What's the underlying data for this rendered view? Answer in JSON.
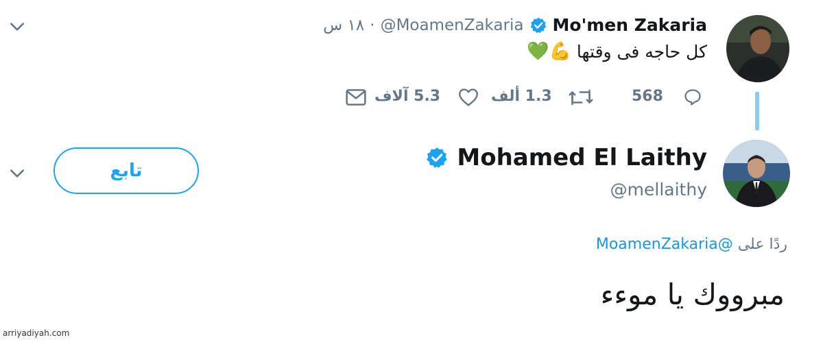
{
  "tweet1": {
    "name": "Mo'men Zakaria",
    "handle": "@MoamenZakaria",
    "time": "١٨ س",
    "separator": "·",
    "text": "كل حاجه فى وقتها",
    "emoji": "💪💚",
    "actions": {
      "replies": "568",
      "retweets": "1.3 ألف",
      "likes": "5.3 آلاف"
    }
  },
  "tweet2": {
    "name": "Mohamed El Laithy",
    "handle": "@mellaithy",
    "follow_label": "تابع",
    "reply_prefix": "ردًا على",
    "reply_handle": "@MoamenZakaria",
    "text": "مبرووك يا موءء"
  },
  "watermark": "arriyadiyah.com",
  "colors": {
    "accent": "#1da1f2",
    "muted": "#657786",
    "thread_line": "#89cdf0",
    "verified": "#1da1f2"
  },
  "icons": [
    "chevron-down-icon",
    "verified-badge-icon",
    "reply-icon",
    "retweet-icon",
    "like-icon",
    "message-icon"
  ]
}
